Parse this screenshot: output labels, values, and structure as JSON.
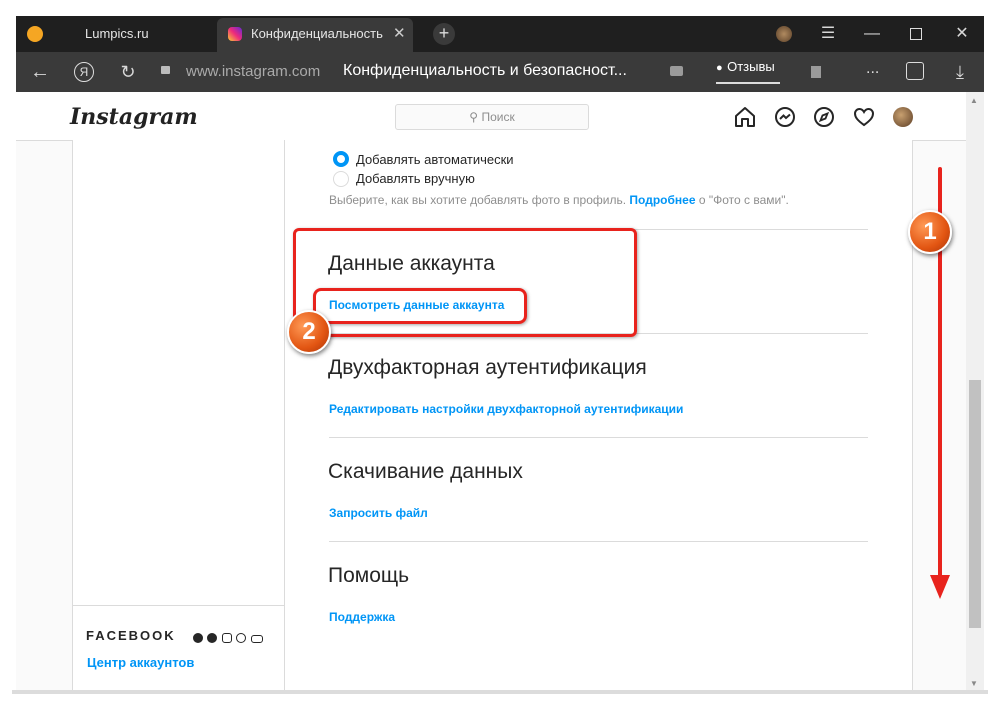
{
  "browser": {
    "tabs": [
      {
        "label": "Lumpics.ru"
      },
      {
        "label": "Конфиденциальность и"
      }
    ],
    "url": "www.instagram.com",
    "page_title": "Конфиденциальность и безопасност...",
    "reviews_label": "Отзывы",
    "more_label": "..."
  },
  "instagram": {
    "logo": "Instagram",
    "search_placeholder": "Поиск"
  },
  "settings": {
    "radio_options": [
      {
        "label": "Добавлять автоматически",
        "selected": true
      },
      {
        "label": "Добавлять вручную",
        "selected": false
      }
    ],
    "photo_help": {
      "prefix": "Выберите, как вы хотите добавлять фото в профиль.",
      "link": "Подробнее",
      "suffix": "о \"Фото с вами\"."
    },
    "sections": [
      {
        "title": "Данные аккаунта",
        "link": "Посмотреть данные аккаунта"
      },
      {
        "title": "Двухфакторная аутентификация",
        "link": "Редактировать настройки двухфакторной аутентификации"
      },
      {
        "title": "Скачивание данных",
        "link": "Запросить файл"
      },
      {
        "title": "Помощь",
        "link": "Поддержка"
      }
    ]
  },
  "sidebar": {
    "facebook_label": "FACEBOOK",
    "accounts_center": "Центр аккаунтов"
  },
  "annotations": {
    "badge_1": "1",
    "badge_2": "2",
    "accent": "#e8231d"
  }
}
